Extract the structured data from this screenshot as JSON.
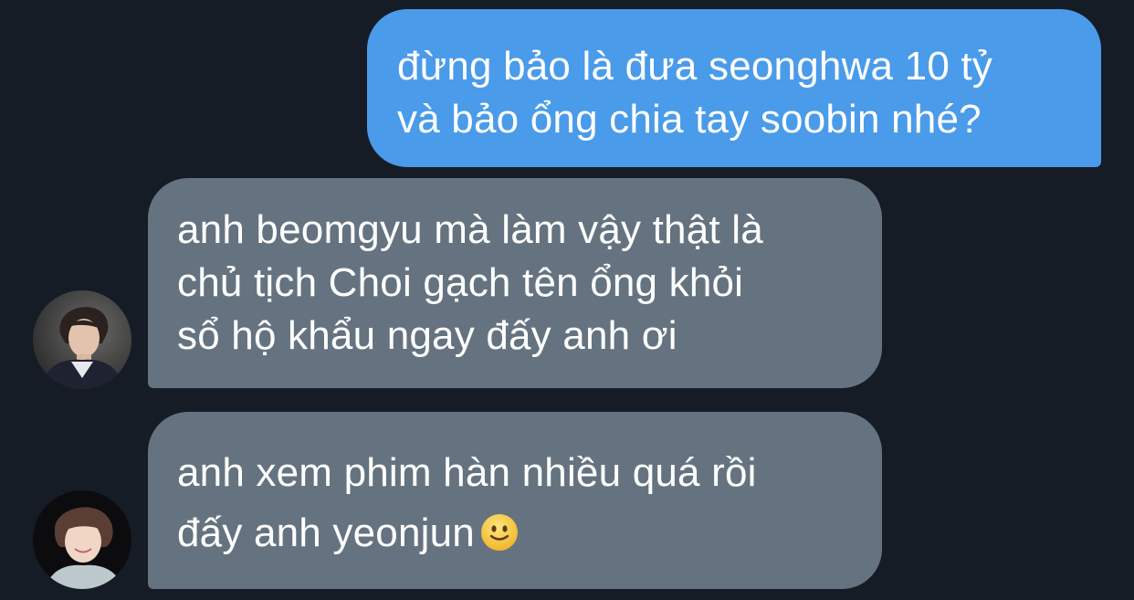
{
  "conversation": {
    "messages": [
      {
        "direction": "outgoing",
        "lines": [
          "đừng bảo là đưa seonghwa 10 tỷ",
          "và bảo ổng chia tay soobin nhé?"
        ]
      },
      {
        "direction": "incoming",
        "lines": [
          "anh beomgyu mà làm vậy thật là",
          "chủ tịch Choi gạch tên ổng khỏi",
          "sổ hộ khẩu ngay đấy anh ơi"
        ],
        "avatar_icon": "avatar-photo-icon"
      },
      {
        "direction": "incoming",
        "lines": [
          "anh xem phim hàn nhiều quá rồi",
          "đấy anh yeonjun"
        ],
        "trailing_emoji": "slightly-smiling-face-icon",
        "avatar_icon": "avatar-photo-icon"
      }
    ]
  },
  "colors": {
    "background": "#151c26",
    "outgoing_bubble": "#4a9be9",
    "incoming_bubble": "#657380",
    "text": "#ffffff"
  }
}
